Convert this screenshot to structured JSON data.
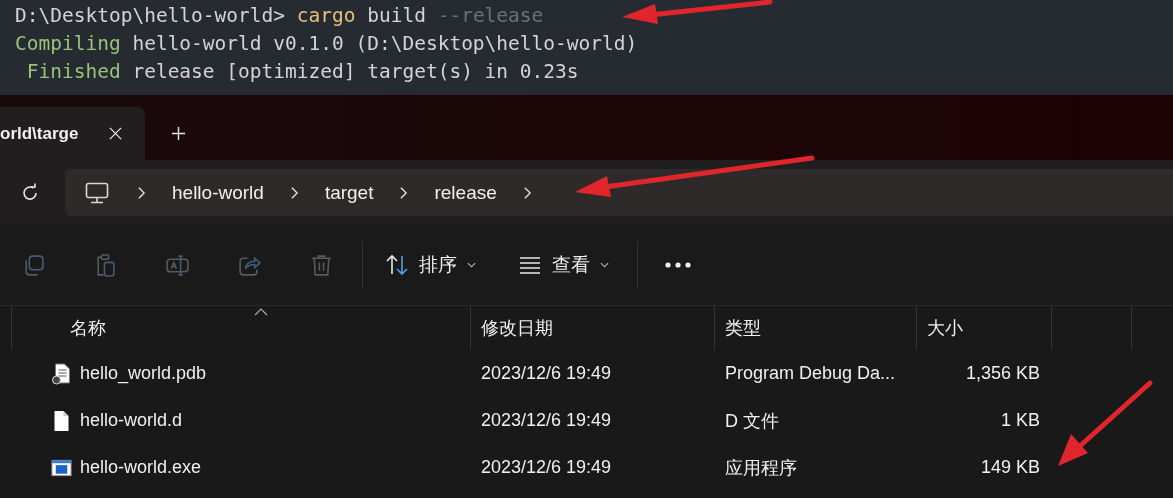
{
  "terminal": {
    "lines": [
      [
        {
          "kind": "prompt",
          "text": "D:\\Desktop\\hello-world> "
        },
        {
          "kind": "command",
          "text": "cargo"
        },
        {
          "kind": "plain",
          "text": " build "
        },
        {
          "kind": "flag",
          "text": "--release"
        }
      ],
      [
        {
          "kind": "status",
          "text": "Compiling"
        },
        {
          "kind": "plain",
          "text": " hello-world v0.1.0 (D:\\Desktop\\hello-world)"
        }
      ],
      [
        {
          "kind": "status",
          "text": " Finished"
        },
        {
          "kind": "plain",
          "text": " release [optimized] target(s) in 0.23s"
        }
      ]
    ]
  },
  "tabs": [
    {
      "label": "orld\\targe",
      "selected": true
    }
  ],
  "breadcrumb": [
    "hello-world",
    "target",
    "release"
  ],
  "toolbar": {
    "icons": [
      {
        "kind": "copy",
        "disabled": true
      },
      {
        "kind": "paste",
        "disabled": true
      },
      {
        "kind": "rename",
        "disabled": true
      },
      {
        "kind": "share",
        "disabled": true
      },
      {
        "kind": "delete",
        "disabled": true
      }
    ],
    "menus": [
      {
        "kind": "sort",
        "label": "排序"
      },
      {
        "kind": "view",
        "label": "查看"
      }
    ]
  },
  "table": {
    "columns": [
      "名称",
      "修改日期",
      "类型",
      "大小"
    ],
    "rows": [
      {
        "kind": "pdb",
        "name": "hello_world.pdb",
        "modified": "2023/12/6 19:49",
        "type": "Program Debug Da...",
        "size": "1,356 KB"
      },
      {
        "kind": "file",
        "name": "hello-world.d",
        "modified": "2023/12/6 19:49",
        "type": "D 文件",
        "size": "1 KB"
      },
      {
        "kind": "exe",
        "name": "hello-world.exe",
        "modified": "2023/12/6 19:49",
        "type": "应用程序",
        "size": "149 KB"
      }
    ]
  }
}
